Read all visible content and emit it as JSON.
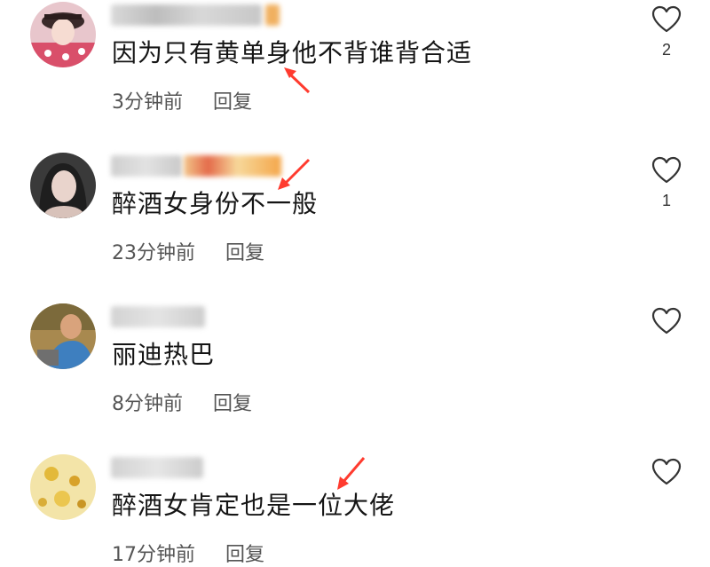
{
  "comments": [
    {
      "text": "因为只有黄单身他不背谁背合适",
      "time": "3分钟前",
      "reply": "回复",
      "likes": "2"
    },
    {
      "text": "醉酒女身份不一般",
      "time": "23分钟前",
      "reply": "回复",
      "likes": "1"
    },
    {
      "text": "丽迪热巴",
      "time": "8分钟前",
      "reply": "回复",
      "likes": ""
    },
    {
      "text": "醉酒女肯定也是一位大佬",
      "time": "17分钟前",
      "reply": "回复",
      "likes": ""
    }
  ],
  "colors": {
    "annotation_arrow": "#ff3b2f",
    "text": "#151515",
    "meta": "#555555"
  },
  "icons": [
    "heart-outline-icon",
    "annotation-arrow"
  ]
}
